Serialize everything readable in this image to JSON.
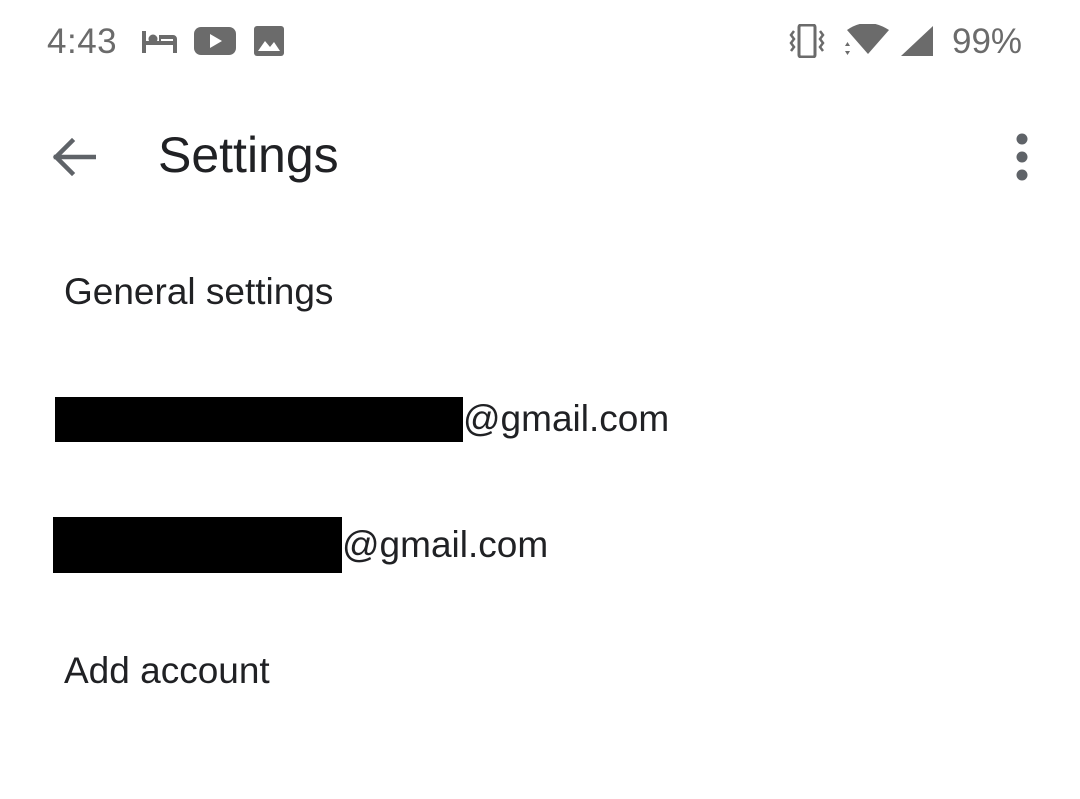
{
  "status_bar": {
    "time": "4:43",
    "battery_percent": "99%",
    "notification_icons": [
      "bed-icon",
      "youtube-icon",
      "image-icon"
    ],
    "system_icons": [
      "vibrate-icon",
      "wifi-icon",
      "cell-signal-icon"
    ],
    "text_color": "#6b6b6b"
  },
  "app_bar": {
    "title": "Settings",
    "back_icon": "arrow-back-icon",
    "overflow_icon": "more-vert-icon"
  },
  "settings_list": {
    "general": "General settings",
    "accounts": [
      {
        "email_suffix": "@gmail.com"
      },
      {
        "email_suffix": "@gmail.com"
      }
    ],
    "add_account": "Add account"
  },
  "colors": {
    "text_primary": "#202124",
    "background": "#ffffff",
    "redaction": "#000000"
  }
}
